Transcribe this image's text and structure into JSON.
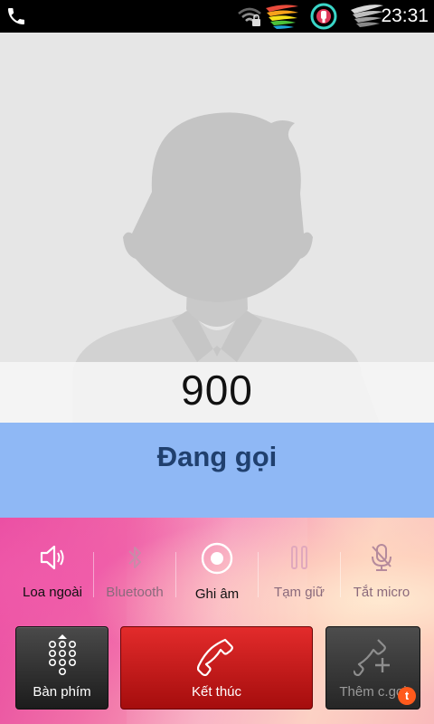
{
  "status_bar": {
    "time": "23:31",
    "icons": [
      "phone-call-icon",
      "wifi-lock-icon",
      "colorful-wing-icon",
      "notification-badge-icon",
      "silver-wing-icon"
    ]
  },
  "contact": {
    "number": "900",
    "avatar": "default-person-silhouette"
  },
  "call": {
    "status": "Đang gọi",
    "status_color": "#8fb8f5"
  },
  "controls": [
    {
      "label": "Loa ngoài",
      "icon": "speaker-icon",
      "enabled": true
    },
    {
      "label": "Bluetooth",
      "icon": "bluetooth-icon",
      "enabled": false
    },
    {
      "label": "Ghi âm",
      "icon": "record-icon",
      "enabled": true
    },
    {
      "label": "Tạm giữ",
      "icon": "pause-icon",
      "enabled": false
    },
    {
      "label": "Tắt micro",
      "icon": "microphone-mute-icon",
      "enabled": false
    }
  ],
  "buttons": {
    "keypad": {
      "label": "Bàn phím",
      "icon": "keypad-icon"
    },
    "end_call": {
      "label": "Kết thúc",
      "icon": "handset-icon",
      "color": "#d41a1a"
    },
    "add_call": {
      "label": "Thêm c.gọi",
      "icon": "add-call-icon",
      "badge": "t"
    }
  }
}
